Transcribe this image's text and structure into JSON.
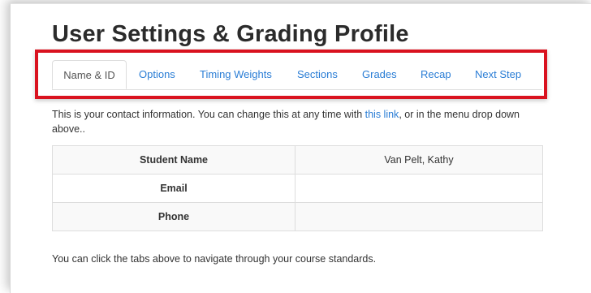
{
  "page": {
    "title": "User Settings & Grading Profile"
  },
  "tabs": [
    {
      "label": "Name & ID",
      "active": true
    },
    {
      "label": "Options",
      "active": false
    },
    {
      "label": "Timing Weights",
      "active": false
    },
    {
      "label": "Sections",
      "active": false
    },
    {
      "label": "Grades",
      "active": false
    },
    {
      "label": "Recap",
      "active": false
    },
    {
      "label": "Next Step",
      "active": false
    }
  ],
  "intro": {
    "before_link": "This is your contact information. You can change this at any time with ",
    "link_text": "this link",
    "after_link": ", or in the menu drop down above.."
  },
  "table": {
    "rows": [
      {
        "label": "Student Name",
        "value": "Van Pelt, Kathy"
      },
      {
        "label": "Email",
        "value": ""
      },
      {
        "label": "Phone",
        "value": ""
      }
    ]
  },
  "footer": {
    "note": "You can click the tabs above to navigate through your course standards."
  },
  "colors": {
    "link": "#2a7dd5",
    "highlight_border": "#d9121f",
    "title": "#2b2b2b"
  }
}
